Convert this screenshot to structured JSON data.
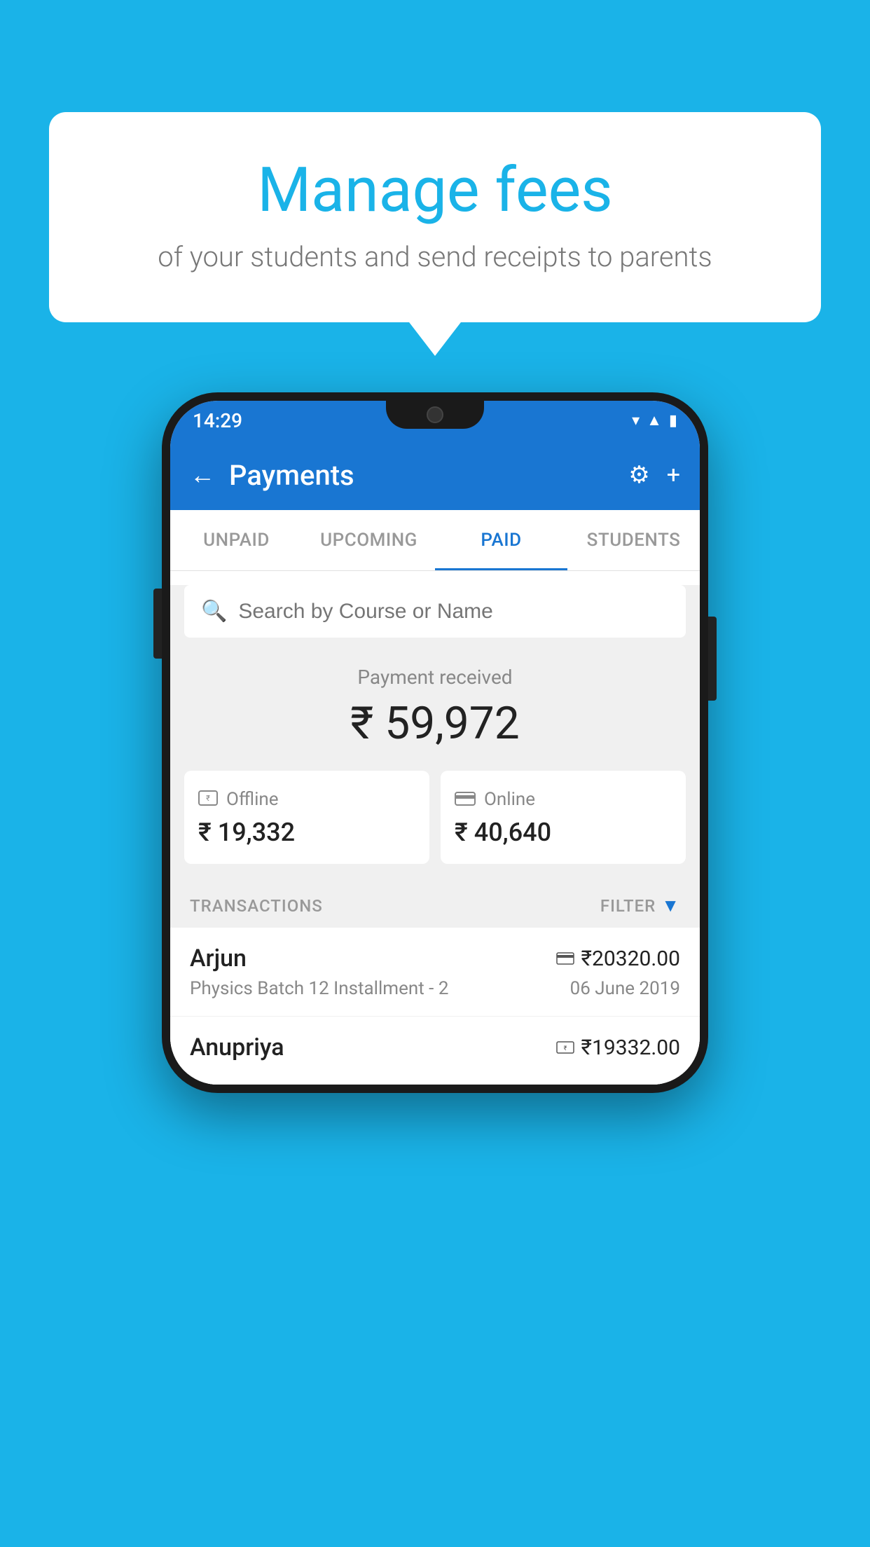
{
  "background_color": "#1ab3e8",
  "speech_bubble": {
    "heading": "Manage fees",
    "subtext": "of your students and send receipts to parents"
  },
  "status_bar": {
    "time": "14:29",
    "icons": [
      "wifi",
      "signal",
      "battery"
    ]
  },
  "app_bar": {
    "title": "Payments",
    "back_label": "←",
    "settings_label": "⚙",
    "add_label": "+"
  },
  "tabs": [
    {
      "label": "UNPAID",
      "active": false
    },
    {
      "label": "UPCOMING",
      "active": false
    },
    {
      "label": "PAID",
      "active": true
    },
    {
      "label": "STUDENTS",
      "active": false
    }
  ],
  "search": {
    "placeholder": "Search by Course or Name"
  },
  "payment_summary": {
    "label": "Payment received",
    "amount": "₹ 59,972",
    "offline": {
      "label": "Offline",
      "amount": "₹ 19,332"
    },
    "online": {
      "label": "Online",
      "amount": "₹ 40,640"
    }
  },
  "transactions_section": {
    "label": "TRANSACTIONS",
    "filter_label": "FILTER"
  },
  "transactions": [
    {
      "name": "Arjun",
      "course": "Physics Batch 12 Installment - 2",
      "amount": "₹20320.00",
      "date": "06 June 2019",
      "payment_type": "online"
    },
    {
      "name": "Anupriya",
      "course": "",
      "amount": "₹19332.00",
      "date": "",
      "payment_type": "offline"
    }
  ]
}
